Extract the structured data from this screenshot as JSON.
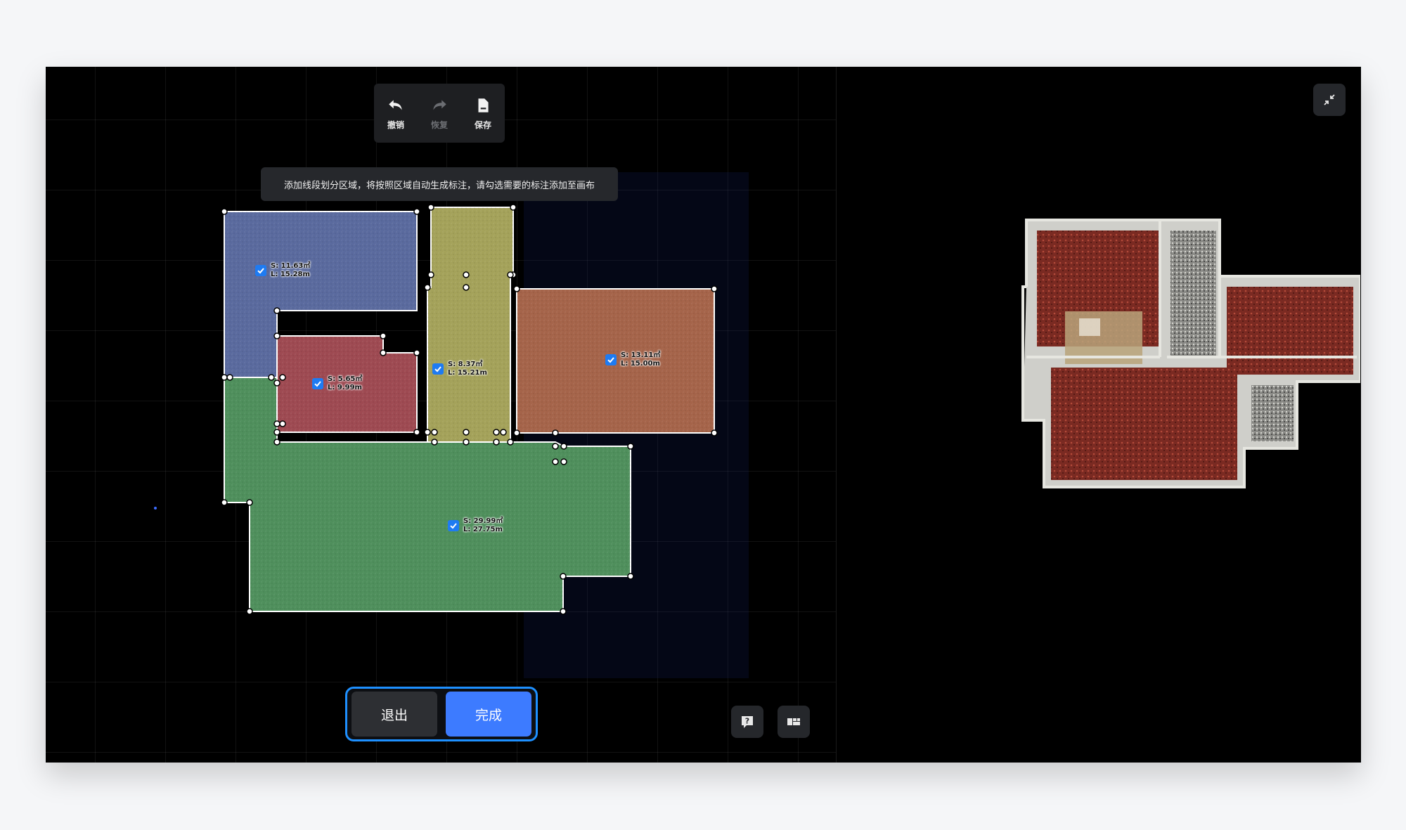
{
  "toolbar": {
    "undo_label": "撤销",
    "redo_label": "恢复",
    "save_label": "保存"
  },
  "hint_text": "添加线段划分区域，将按照区域自动生成标注，请勾选需要的标注添加至画布",
  "rooms": [
    {
      "area": "S: 11.63㎡",
      "perimeter": "L: 15.28m",
      "checked": true,
      "color": "#5a6a9e"
    },
    {
      "area": "S: 5.65㎡",
      "perimeter": "L: 9.99m",
      "checked": true,
      "color": "#9e4a52"
    },
    {
      "area": "S: 8.37㎡",
      "perimeter": "L: 15.21m",
      "checked": true,
      "color": "#a4a25a"
    },
    {
      "area": "S: 13.11㎡",
      "perimeter": "L: 15.00m",
      "checked": true,
      "color": "#a5644a"
    },
    {
      "area": "S: 29.99㎡",
      "perimeter": "L: 27.75m",
      "checked": true,
      "color": "#4f8f5c"
    }
  ],
  "actions": {
    "exit_label": "退出",
    "done_label": "完成"
  },
  "icons": {
    "undo": "undo-icon",
    "redo": "redo-icon",
    "save": "save-icon",
    "help": "help-icon",
    "layout": "layout-icon",
    "collapse": "collapse-icon"
  },
  "colors": {
    "accent": "#3d7bff",
    "checkbox": "#1e7bf2",
    "focus_border": "#1e90ff"
  }
}
